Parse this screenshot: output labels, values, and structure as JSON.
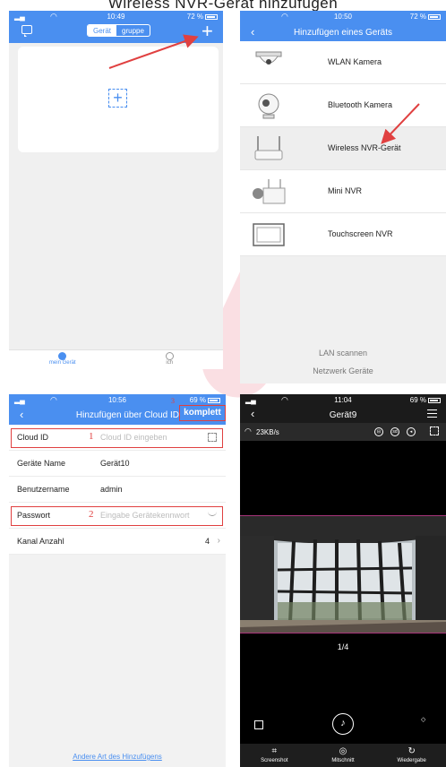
{
  "page_title": "Wireless NVR-Gerät hinzufügen",
  "phone1": {
    "time": "10:49",
    "battery": "72 %",
    "tabs_toggle": {
      "geraet": "Gerät",
      "gruppe": "gruppe"
    },
    "add_symbol": "+",
    "tabbar": {
      "mine": "mein Gerät",
      "me": "ich"
    }
  },
  "phone2": {
    "time": "10:50",
    "battery": "72 %",
    "title": "Hinzufügen eines Geräts",
    "devices": [
      {
        "label": "WLAN Kamera"
      },
      {
        "label": "Bluetooth Kamera"
      },
      {
        "label": "Wireless NVR-Gerät"
      },
      {
        "label": "Mini NVR"
      },
      {
        "label": "Touchscreen NVR"
      }
    ],
    "lan_scan": "LAN scannen",
    "network_devices": "Netzwerk Geräte"
  },
  "phone3": {
    "time": "10:56",
    "battery": "69 %",
    "title": "Hinzufügen über Cloud ID",
    "done": "komplett",
    "marker3": "3",
    "fields": {
      "cloud_id": {
        "label": "Cloud ID",
        "placeholder": "Cloud ID eingeben",
        "marker": "1"
      },
      "name": {
        "label": "Geräte Name",
        "value": "Gerät10"
      },
      "user": {
        "label": "Benutzername",
        "value": "admin"
      },
      "password": {
        "label": "Passwort",
        "placeholder": "Eingabe Gerätekennwort",
        "marker": "2"
      },
      "channels": {
        "label": "Kanal Anzahl",
        "value": "4"
      }
    },
    "other_link": "Andere Art des Hinzufügens"
  },
  "phone4": {
    "time": "11:04",
    "battery": "69 %",
    "title": "Gerät9",
    "speed": "23KB/s",
    "page_indicator": "1/4",
    "bottom": {
      "screenshot": "Screenshot",
      "record": "Mitschnitt",
      "playback": "Wiedergabe"
    }
  },
  "colors": {
    "accent": "#4a8ff0",
    "annotation": "#e04040",
    "video_border": "#a7347a"
  }
}
